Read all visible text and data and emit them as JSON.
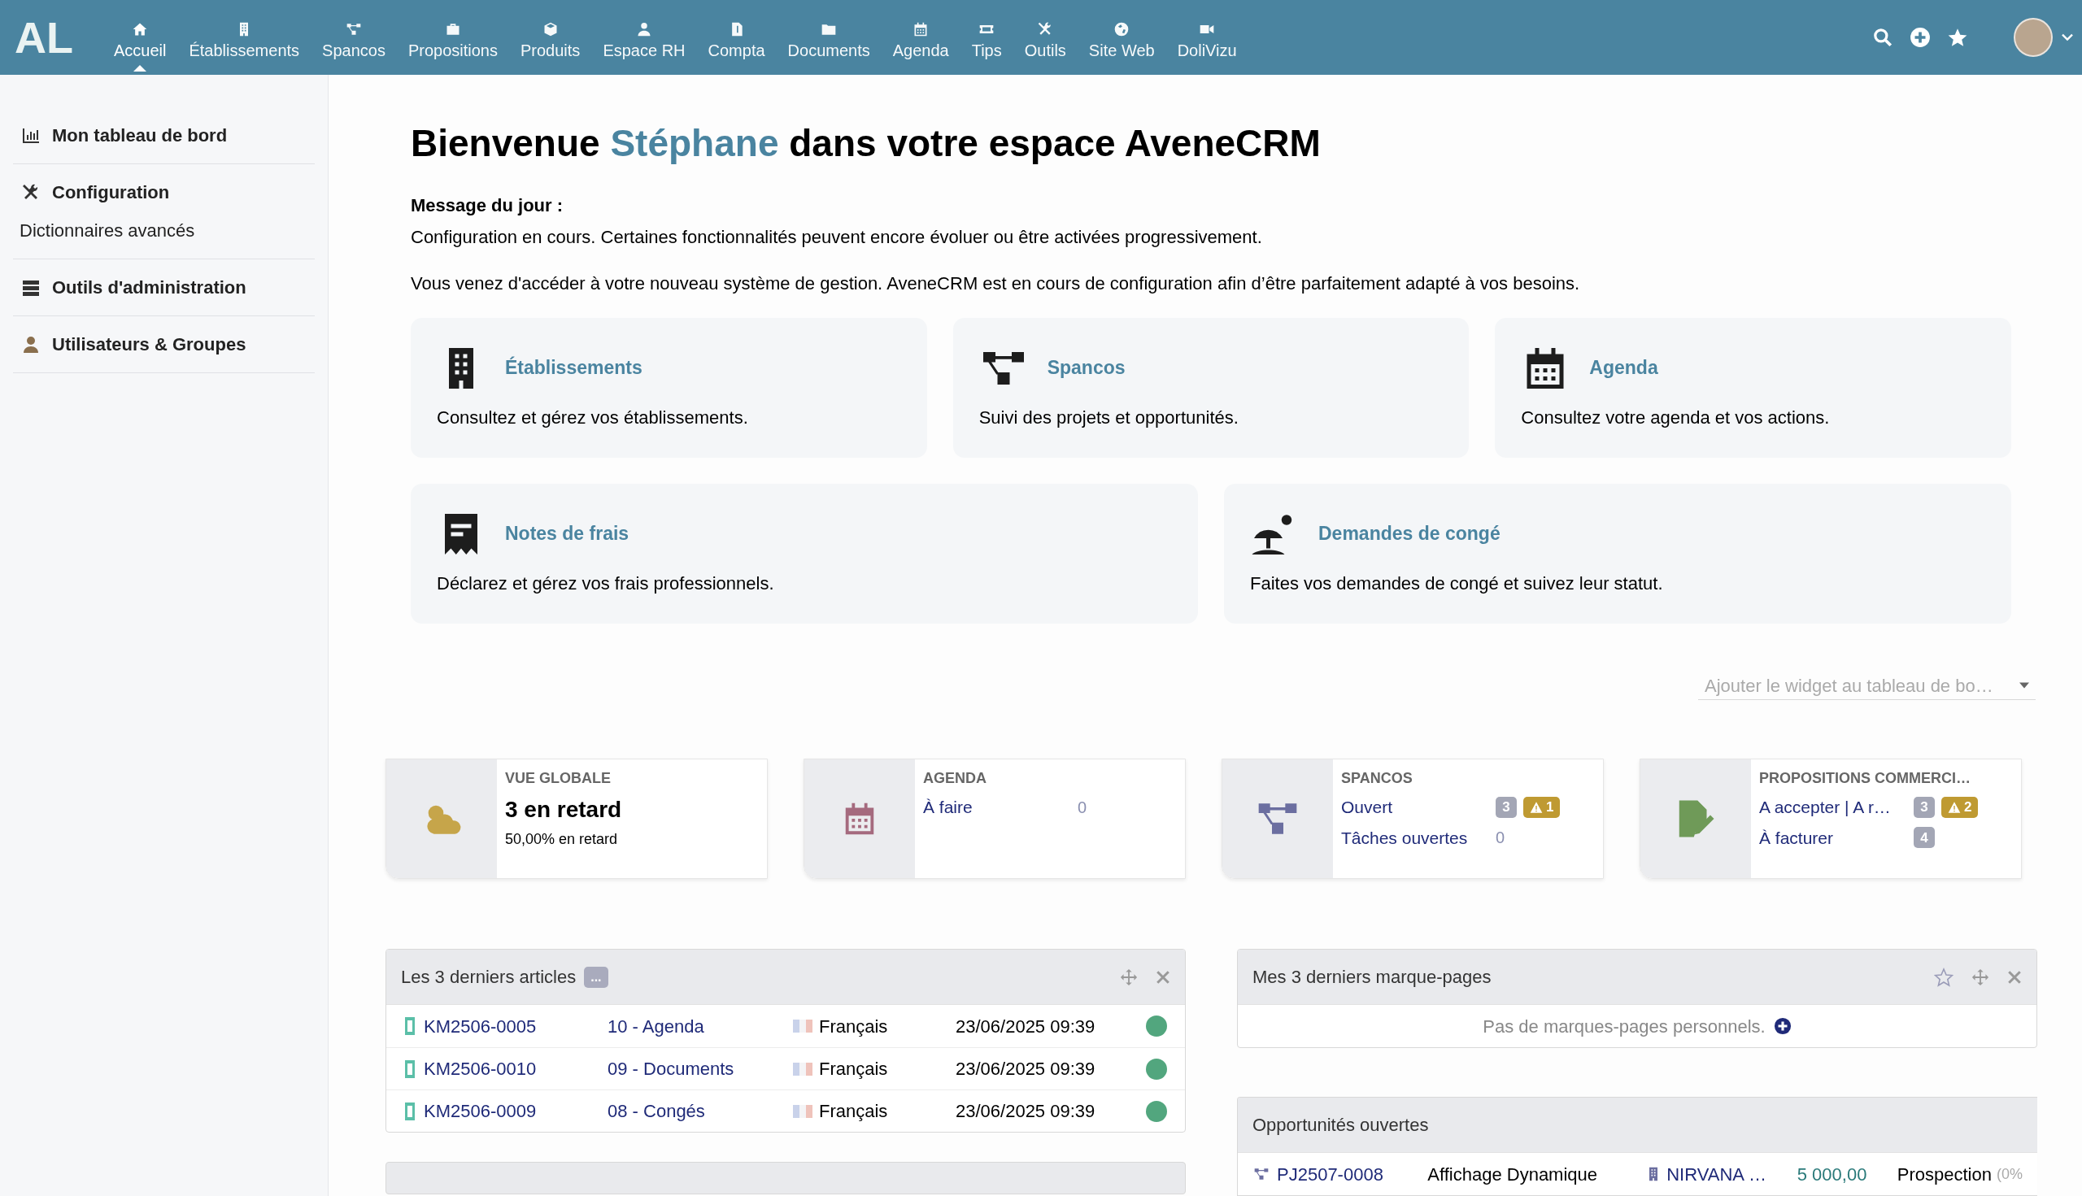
{
  "top_bar": {
    "logo_text": "AL",
    "nav": [
      {
        "label": "Accueil",
        "selected": true
      },
      {
        "label": "Établissements",
        "selected": false
      },
      {
        "label": "Spancos",
        "selected": false
      },
      {
        "label": "Propositions",
        "selected": false
      },
      {
        "label": "Produits",
        "selected": false
      },
      {
        "label": "Espace RH",
        "selected": false
      },
      {
        "label": "Compta",
        "selected": false
      },
      {
        "label": "Documents",
        "selected": false
      },
      {
        "label": "Agenda",
        "selected": false
      },
      {
        "label": "Tips",
        "selected": false
      },
      {
        "label": "Outils",
        "selected": false
      },
      {
        "label": "Site Web",
        "selected": false
      },
      {
        "label": "DoliVizu",
        "selected": false
      }
    ]
  },
  "sidebar": {
    "sections": [
      {
        "label": "Mon tableau de bord",
        "kind": "chart"
      },
      {
        "label": "Configuration",
        "kind": "tools",
        "children": [
          {
            "label": "Dictionnaires avancés"
          }
        ]
      },
      {
        "label": "Outils d'administration",
        "kind": "server"
      },
      {
        "label": "Utilisateurs & Groupes",
        "kind": "user"
      }
    ]
  },
  "welcome": {
    "title_before": "Bienvenue ",
    "name": "Stéphane",
    "title_after": " dans votre espace AveneCRM",
    "message_heading": "Message du jour :",
    "message": "Configuration en cours. Certaines fonctionnalités peuvent encore évoluer ou être activées progressivement.",
    "intro": "Vous venez d'accéder à votre nouveau système de gestion. AveneCRM est en cours de configuration afin d’être parfaitement adapté à vos besoins."
  },
  "shortcut_cards": [
    {
      "kind": "building",
      "title": "Établissements",
      "description": "Consultez et gérez vos établissements."
    },
    {
      "kind": "flow",
      "title": "Spancos",
      "description": "Suivi des projets et opportunités."
    },
    {
      "kind": "calendar",
      "title": "Agenda",
      "description": "Consultez votre agenda et vos actions."
    },
    {
      "kind": "receipt",
      "title": "Notes de frais",
      "description": "Déclarez et gérez vos frais professionnels."
    },
    {
      "kind": "beach",
      "title": "Demandes de congé",
      "description": "Faites vos demandes de congé et suivez leur statut."
    }
  ],
  "widget_select": {
    "placeholder": "Ajouter le widget au tableau de bo…"
  },
  "stat_boxes": [
    {
      "kind": "summary",
      "title": "VUE GLOBALE",
      "headline": "3 en retard",
      "subline": "50,00% en retard"
    },
    {
      "kind": "agenda",
      "title": "AGENDA",
      "lines": [
        {
          "label": "À faire",
          "value": "0"
        }
      ]
    },
    {
      "kind": "spancos",
      "title": "SPANCOS",
      "lines": [
        {
          "label": "Ouvert",
          "badges": [
            {
              "kind": "count",
              "text": "3"
            },
            {
              "kind": "warning",
              "text": "1"
            }
          ]
        },
        {
          "label": "Tâches ouvertes",
          "value": "0"
        }
      ]
    },
    {
      "kind": "proposals",
      "title": "PROPOSITIONS COMMERCI…",
      "lines": [
        {
          "label": "A accepter | A r…",
          "badges": [
            {
              "kind": "count",
              "text": "3"
            },
            {
              "kind": "warning",
              "text": "2"
            }
          ]
        },
        {
          "label": "À facturer",
          "badges": [
            {
              "kind": "count",
              "text": "4"
            }
          ]
        }
      ]
    }
  ],
  "articles_panel": {
    "title": "Les 3 derniers articles",
    "more": "...",
    "rows": [
      {
        "ref": "KM2506-0005",
        "title": "10 - Agenda",
        "language": "Français",
        "date": "23/06/2025 09:39",
        "active": true
      },
      {
        "ref": "KM2506-0010",
        "title": "09 - Documents",
        "language": "Français",
        "date": "23/06/2025 09:39",
        "active": true
      },
      {
        "ref": "KM2506-0009",
        "title": "08 - Congés",
        "language": "Français",
        "date": "23/06/2025 09:39",
        "active": true
      }
    ]
  },
  "bookmarks_panel": {
    "title": "Mes 3 derniers marque-pages",
    "empty_text": "Pas de marques-pages personnels."
  },
  "opportunities_panel": {
    "title": "Opportunités ouvertes",
    "rows": [
      {
        "ref": "PJ2507-0008",
        "label": "Affichage Dynamique",
        "company": "NIRVANA …",
        "amount": "5 000,00",
        "status": "Prospection",
        "percent": "(0%"
      }
    ]
  }
}
